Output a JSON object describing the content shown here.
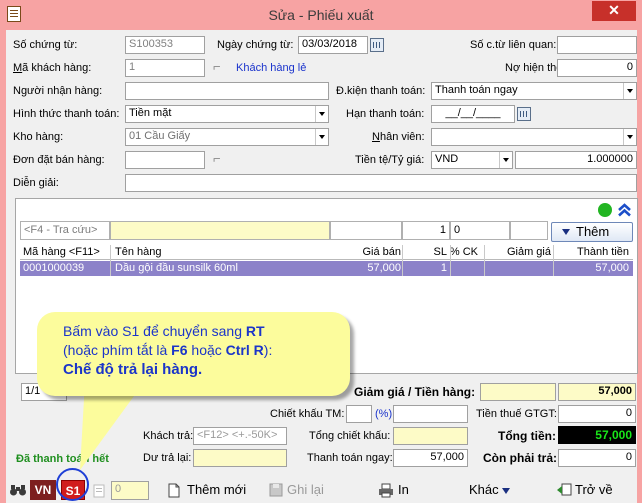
{
  "window": {
    "title": "Sửa - Phiếu xuất",
    "close_label": "✕"
  },
  "header": {
    "so_chung_tu_label": "Số chứng từ:",
    "so_chung_tu_value": "S100353",
    "ngay_chung_tu_label": "Ngày chứng từ:",
    "ngay_chung_tu_value": "03/03/2018",
    "so_ct_lien_quan_label": "Số c.từ liên quan:",
    "so_ct_lien_quan_value": "",
    "ma_khach_hang_label_u": "M",
    "ma_khach_hang_label_rest": "ã khách hàng:",
    "ma_khach_hang_value": "1",
    "khach_hang_le_link": "Khách hàng lẻ",
    "no_hien_thoi_label": "Nợ hiện thời:",
    "no_hien_thoi_value": "0",
    "nguoi_nhan_hang_label": "Người nhận hàng:",
    "nguoi_nhan_hang_value": "",
    "dk_thanh_toan_label": "Đ.kiện thanh toán:",
    "dk_thanh_toan_value": "Thanh toán ngay",
    "hinh_thuc_tt_label": "Hình thức thanh toán:",
    "hinh_thuc_tt_value": "Tiền mặt",
    "han_thanh_toan_label": "Hạn thanh toán:",
    "han_thanh_toan_value": "__/__/____",
    "kho_hang_label": "Kho hàng:",
    "kho_hang_value": "01 Cầu Giấy",
    "nhan_vien_label_u": "N",
    "nhan_vien_label_rest": "hân viên:",
    "nhan_vien_value": "",
    "don_dat_ban_hang_label": "Đơn đặt bán hàng:",
    "don_dat_ban_hang_value": "",
    "tien_te_label": "Tiền tệ/Tỷ giá:",
    "tien_te_value": "VND",
    "ty_gia_value": "1.000000",
    "dien_giai_label": "Diễn giải:",
    "dien_giai_value": ""
  },
  "entry": {
    "lookup_placeholder": "<F4 - Tra cứu>",
    "qty_value": "1",
    "ck_value": "0",
    "add_button": "Thêm"
  },
  "table": {
    "headers": [
      "Mã hàng <F11>",
      "Tên hàng",
      "Giá bán",
      "SL",
      "% CK",
      "Giảm giá",
      "Thành tiền"
    ],
    "rows": [
      {
        "ma": "0001000039",
        "ten": "Dầu gội đầu sunsilk 60ml",
        "gia": "57,000",
        "sl": "1",
        "ck": "",
        "giam": "",
        "thanh_tien": "57,000"
      }
    ]
  },
  "callout": {
    "line1_a": "Bấm vào S1 để chuyển sang ",
    "line1_b": "RT",
    "line2_a": "(hoặc phím tắt là ",
    "line2_b": "F6",
    "line2_c": " hoặc ",
    "line2_d": "Ctrl R",
    "line2_e": "):",
    "line3": "Chế độ trả lại hàng."
  },
  "summary": {
    "page_indicator": "1/1",
    "giam_gia_tien_hang_label": "Giảm giá / Tiền hàng:",
    "giam_gia_value": "",
    "tien_hang_value": "57,000",
    "chiet_khau_tm_label": "Chiết khấu TM:",
    "percent_label": "(%)",
    "tien_thue_gtgt_label": "Tiền thuế GTGT:",
    "tien_thue_gtgt_value": "0",
    "khach_tra_label": "Khách trả:",
    "khach_tra_placeholder": "<F12> <+.-50K>",
    "tong_chiet_khau_label": "Tổng chiết khấu:",
    "tong_tien_label": "Tổng tiền:",
    "tong_tien_value": "57,000",
    "du_tra_lai_label": "Dư trả lại:",
    "thanh_toan_ngay_label": "Thanh toán ngay:",
    "thanh_toan_ngay_value": "57,000",
    "con_phai_tra_label": "Còn phải trả:",
    "con_phai_tra_value": "0",
    "da_thanh_toan_label": "Đã thanh toán hết"
  },
  "toolbar": {
    "vn_label": "VN",
    "s1_label": "S1",
    "copies_value": "0",
    "them_moi": "Thêm mới",
    "ghi_lai": "Ghi lại",
    "in": "In",
    "khac": "Khác",
    "tro_ve": "Trở về"
  }
}
